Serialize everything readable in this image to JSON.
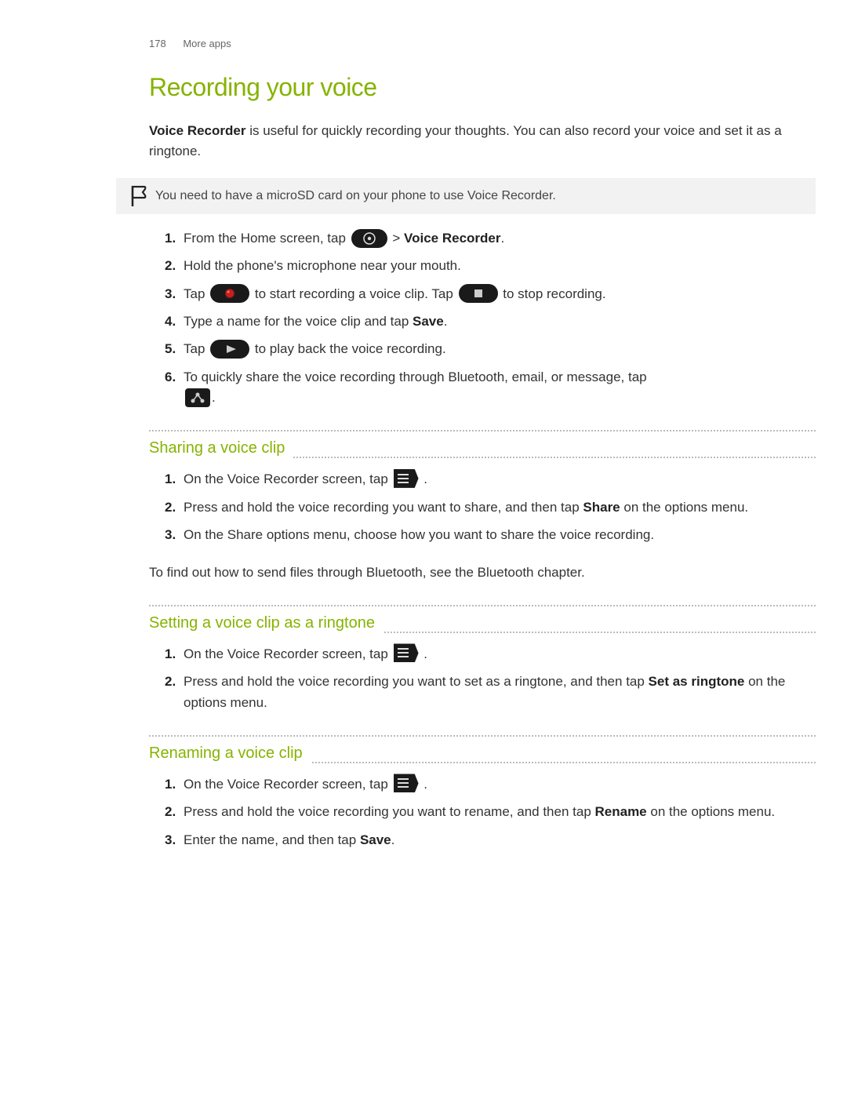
{
  "header": {
    "page_number": "178",
    "section": "More apps"
  },
  "title": "Recording your voice",
  "intro_bold": "Voice Recorder",
  "intro_rest": " is useful for quickly recording your thoughts. You can also record your voice and set it as a ringtone.",
  "note": "You need to have a microSD card on your phone to use Voice Recorder.",
  "main_steps": {
    "s1_a": "From the Home screen, tap ",
    "s1_b": " > ",
    "s1_c": "Voice Recorder",
    "s1_d": ".",
    "s2": "Hold the phone's microphone near your mouth.",
    "s3_a": "Tap ",
    "s3_b": " to start recording a voice clip. Tap ",
    "s3_c": " to stop recording.",
    "s4_a": "Type a name for the voice clip and tap ",
    "s4_b": "Save",
    "s4_c": ".",
    "s5_a": "Tap ",
    "s5_b": " to play back the voice recording.",
    "s6_a": "To quickly share the voice recording through Bluetooth, email, or message, tap ",
    "s6_b": "."
  },
  "sharing": {
    "heading": "Sharing a voice clip",
    "s1_a": "On the Voice Recorder screen, tap ",
    "s1_b": " .",
    "s2_a": "Press and hold the voice recording you want to share, and then tap ",
    "s2_b": "Share",
    "s2_c": " on the options menu.",
    "s3": "On the Share options menu, choose how you want to share the voice recording.",
    "footer": "To find out how to send files through Bluetooth, see the Bluetooth chapter."
  },
  "ringtone": {
    "heading": "Setting a voice clip as a ringtone",
    "s1_a": "On the Voice Recorder screen, tap ",
    "s1_b": " .",
    "s2_a": "Press and hold the voice recording you want to set as a ringtone, and then tap ",
    "s2_b": "Set as ringtone",
    "s2_c": " on the options menu."
  },
  "renaming": {
    "heading": "Renaming a voice clip",
    "s1_a": "On the Voice Recorder screen, tap ",
    "s1_b": " .",
    "s2_a": "Press and hold the voice recording you want to rename, and then tap ",
    "s2_b": "Rename",
    "s2_c": " on the options menu.",
    "s3_a": "Enter the name, and then tap ",
    "s3_b": "Save",
    "s3_c": "."
  }
}
